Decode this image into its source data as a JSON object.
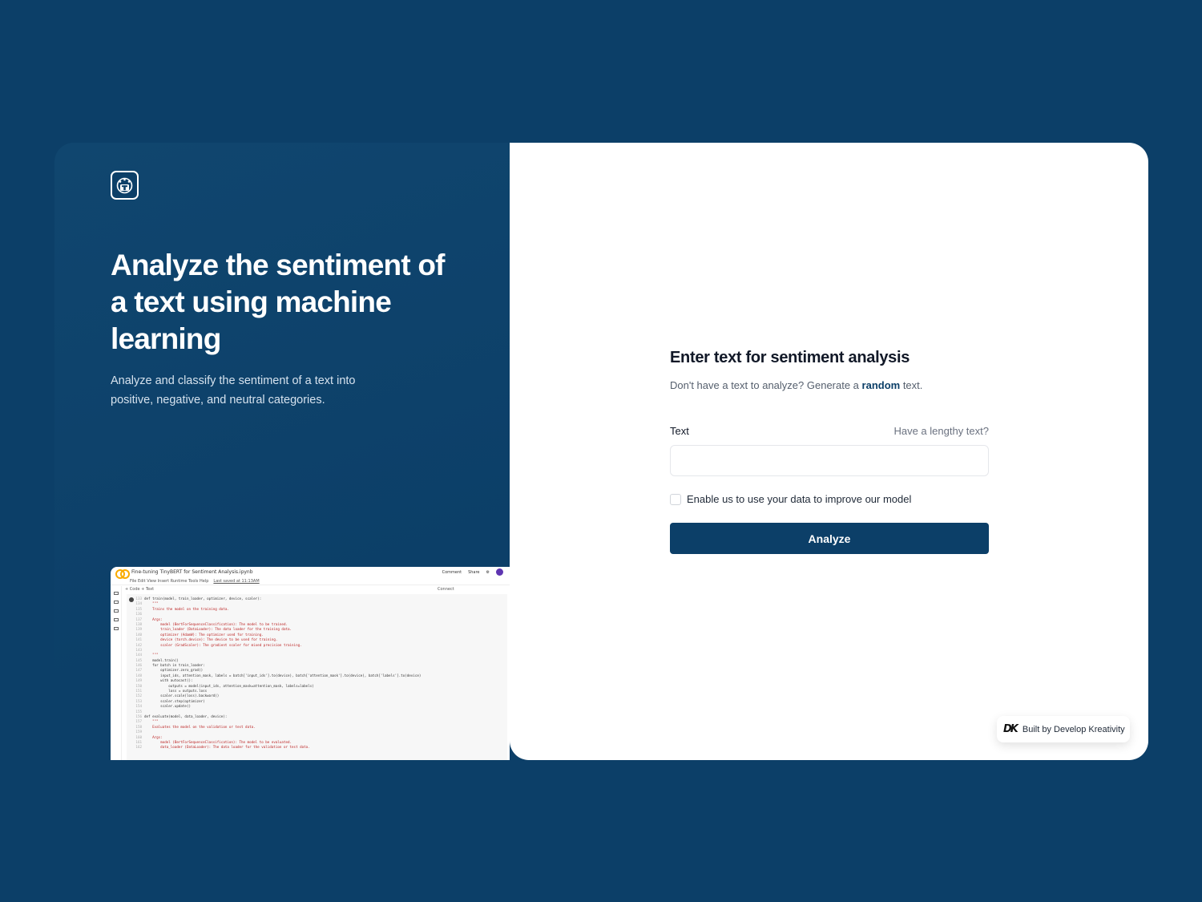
{
  "hero": {
    "title": "Analyze the sentiment of a text using machine learning",
    "subtitle": "Analyze and classify the sentiment of a text into positive, negative, and neutral categories."
  },
  "notebook": {
    "file_title": "Fine-tuning TinyBERT for Sentiment Analysis.ipynb",
    "menu": "File  Edit  View  Insert  Runtime  Tools  Help",
    "last_saved": "Last saved at 11:13AM",
    "comment": "Comment",
    "share": "Share",
    "toolbar": "+ Code  + Text",
    "connect": "Connect",
    "code_lines": [
      {
        "n": "133",
        "t": "def train(model, train_loader, optimizer, device, scaler):",
        "s": false
      },
      {
        "n": "134",
        "t": "    \"\"\"",
        "s": true
      },
      {
        "n": "135",
        "t": "    Trains the model on the training data.",
        "s": true
      },
      {
        "n": "136",
        "t": "",
        "s": false
      },
      {
        "n": "137",
        "t": "    Args:",
        "s": true
      },
      {
        "n": "138",
        "t": "        model (BertForSequenceClassification): The model to be trained.",
        "s": true
      },
      {
        "n": "139",
        "t": "        train_loader (DataLoader): The data loader for the training data.",
        "s": true
      },
      {
        "n": "140",
        "t": "        optimizer (AdamW): The optimizer used for training.",
        "s": true
      },
      {
        "n": "141",
        "t": "        device (torch.device): The device to be used for training.",
        "s": true
      },
      {
        "n": "142",
        "t": "        scaler (GradScaler): The gradient scaler for mixed precision training.",
        "s": true
      },
      {
        "n": "143",
        "t": "",
        "s": false
      },
      {
        "n": "144",
        "t": "    \"\"\"",
        "s": true
      },
      {
        "n": "145",
        "t": "    model.train()",
        "s": false
      },
      {
        "n": "146",
        "t": "    for batch in train_loader:",
        "s": false
      },
      {
        "n": "147",
        "t": "        optimizer.zero_grad()",
        "s": false
      },
      {
        "n": "148",
        "t": "        input_ids, attention_mask, labels = batch['input_ids'].to(device), batch['attention_mask'].to(device), batch['labels'].to(device)",
        "s": false
      },
      {
        "n": "149",
        "t": "        with autocast():",
        "s": false
      },
      {
        "n": "150",
        "t": "            outputs = model(input_ids, attention_mask=attention_mask, labels=labels)",
        "s": false
      },
      {
        "n": "151",
        "t": "            loss = outputs.loss",
        "s": false
      },
      {
        "n": "152",
        "t": "        scaler.scale(loss).backward()",
        "s": false
      },
      {
        "n": "153",
        "t": "        scaler.step(optimizer)",
        "s": false
      },
      {
        "n": "154",
        "t": "        scaler.update()",
        "s": false
      },
      {
        "n": "155",
        "t": "",
        "s": false
      },
      {
        "n": "156",
        "t": "def evaluate(model, data_loader, device):",
        "s": false
      },
      {
        "n": "157",
        "t": "    \"\"\"",
        "s": true
      },
      {
        "n": "158",
        "t": "    Evaluates the model on the validation or test data.",
        "s": true
      },
      {
        "n": "159",
        "t": "",
        "s": false
      },
      {
        "n": "160",
        "t": "    Args:",
        "s": true
      },
      {
        "n": "161",
        "t": "        model (BertForSequenceClassification): The model to be evaluated.",
        "s": true
      },
      {
        "n": "162",
        "t": "        data_loader (DataLoader): The data loader for the validation or test data.",
        "s": true
      }
    ]
  },
  "form": {
    "title": "Enter text for sentiment analysis",
    "sub_before": "Don't have a text to analyze? Generate a ",
    "sub_link": "random",
    "sub_after": " text.",
    "text_label": "Text",
    "lengthy_hint": "Have a lengthy text?",
    "text_value": "",
    "consent_label": "Enable us to use your data to improve our model",
    "consent_checked": false,
    "analyze_label": "Analyze"
  },
  "footer": {
    "built_by_mark": "DK",
    "built_by": "Built by Develop Kreativity"
  },
  "colors": {
    "background": "#0c3f68",
    "primary": "#0c3f68",
    "card": "#ffffff"
  }
}
